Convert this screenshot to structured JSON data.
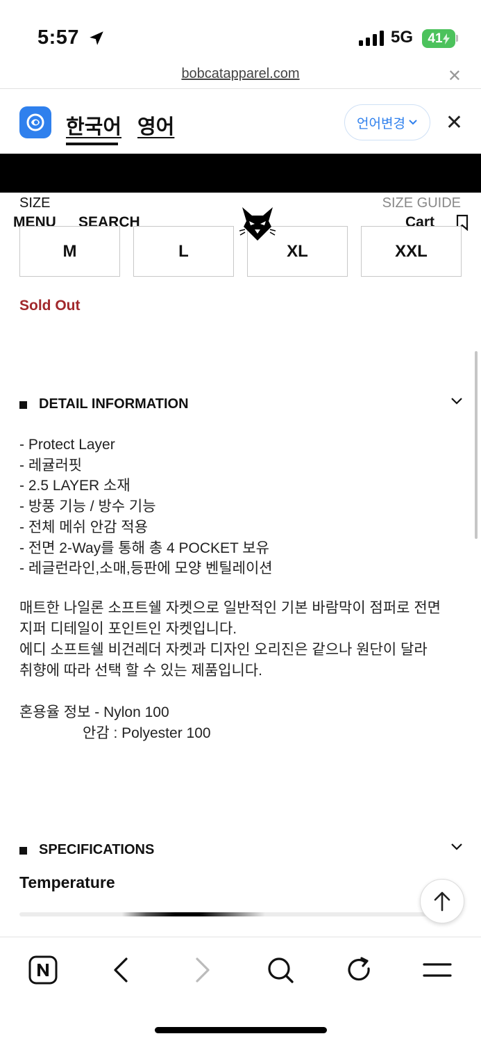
{
  "status": {
    "time": "5:57",
    "network": "5G",
    "battery": "41"
  },
  "browser": {
    "url": "bobcatapparel.com"
  },
  "translate": {
    "tab_korean": "한국어",
    "tab_english": "영어",
    "change_language": "언어변경"
  },
  "nav": {
    "size_label": "SIZE",
    "size_guide": "SIZE GUIDE",
    "menu": "MENU",
    "search": "SEARCH",
    "cart": "Cart"
  },
  "sizes": [
    "M",
    "L",
    "XL",
    "XXL"
  ],
  "sold_out": "Sold Out",
  "detail": {
    "heading": "DETAIL INFORMATION",
    "bullets": [
      "- Protect Layer",
      "- 레귤러핏",
      "- 2.5 LAYER 소재",
      "- 방풍 기능 / 방수 기능",
      "- 전체 메쉬 안감 적용",
      "- 전면 2-Way를 통해 총 4 POCKET 보유",
      "- 레글런라인,소매,등판에 모양 벤틸레이션"
    ],
    "description": [
      "매트한 나일론 소프트쉘 자켓으로 일반적인 기본 바람막이 점퍼로 전면",
      "지퍼 디테일이 포인트인 자켓입니다.",
      "에디 소프트쉘 비건레더 자켓과 디자인 오리진은 같으나 원단이 달라",
      "취향에 따라 선택 할 수 있는 제품입니다."
    ],
    "blend_line_1": "혼용율 정보 - Nylon 100",
    "blend_line_2": "안감 : Polyester 100"
  },
  "specs": {
    "heading": "SPECIFICATIONS",
    "temperature_label": "Temperature"
  },
  "icons": {
    "location": "location-arrow-icon",
    "signal": "signal-bars-icon",
    "close": "close-icon",
    "translate": "translate-app-icon",
    "chevron": "chevron-down-icon",
    "bookmark": "bookmark-icon",
    "logo": "bobcat-logo-icon",
    "scroll_top": "arrow-up-icon",
    "naver": "naver-home-icon",
    "back": "back-arrow-icon",
    "forward": "forward-arrow-icon",
    "search": "search-icon",
    "reload": "reload-icon",
    "menu": "hamburger-menu-icon"
  },
  "colors": {
    "accent": "#2f80ed",
    "sold_out": "#a1282c",
    "battery": "#4cc25c"
  }
}
